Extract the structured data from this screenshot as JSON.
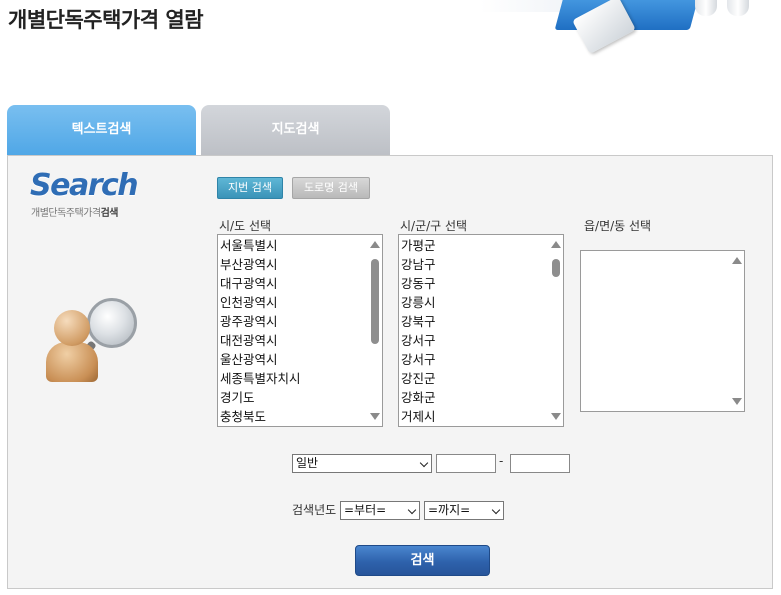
{
  "header": {
    "title": "개별단독주택가격 열람"
  },
  "tabs": [
    {
      "label": "텍스트검색",
      "active": true
    },
    {
      "label": "지도검색",
      "active": false
    }
  ],
  "panel": {
    "logo_text": "Search",
    "logo_sub_plain": "개별단독주택가격",
    "logo_sub_bold": "검색",
    "search_types": [
      {
        "label": "지번 검색",
        "active": true
      },
      {
        "label": "도로명 검색",
        "active": false
      }
    ],
    "sido": {
      "label": "시/도 선택",
      "options": [
        "서울특별시",
        "부산광역시",
        "대구광역시",
        "인천광역시",
        "광주광역시",
        "대전광역시",
        "울산광역시",
        "세종특별자치시",
        "경기도",
        "충청북도"
      ]
    },
    "sigungu": {
      "label": "시/군/구 선택",
      "options": [
        "가평군",
        "강남구",
        "강동구",
        "강릉시",
        "강북구",
        "강서구",
        "강서구",
        "강진군",
        "강화군",
        "거제시"
      ]
    },
    "eupmyeondong": {
      "label": "읍/면/동 선택",
      "options": []
    },
    "address": {
      "land_type_selected": "일반",
      "main_number": "",
      "sub_number": "",
      "separator": "-"
    },
    "year": {
      "label": "검색년도",
      "from_selected": "=부터=",
      "to_selected": "=까지="
    },
    "search_button": "검색"
  },
  "colors": {
    "active_tab": "#4ea6e6",
    "inactive_tab": "#bcbfc5",
    "search_button": "#2e62ac",
    "jibun_button": "#3a93b8"
  }
}
